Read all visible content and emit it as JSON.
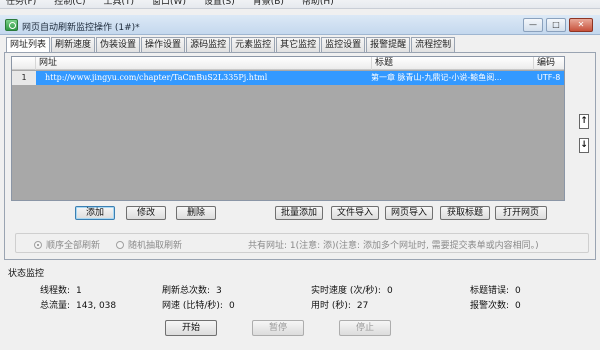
{
  "menu": [
    "任务(F)",
    "控制(C)",
    "工具(T)",
    "窗口(W)",
    "设置(S)",
    "背景(B)",
    "帮助(H)"
  ],
  "window": {
    "title": "网页自动刷新监控操作  (1#)*",
    "min": "—",
    "max": "□",
    "close": "✕"
  },
  "tabs": [
    "网址列表",
    "刷新速度",
    "伪装设置",
    "操作设置",
    "源码监控",
    "元素监控",
    "其它监控",
    "监控设置",
    "报警提醒",
    "流程控制"
  ],
  "table": {
    "headers": {
      "url": "网址",
      "title": "标题",
      "encoding": "编码"
    },
    "rows": [
      {
        "index": "1",
        "url": "http://www.jingyu.com/chapter/TaCmBuS2L335Pj.html",
        "title": "第一章 脉青山-九鼎记-小说-鲸鱼阅...",
        "encoding": "UTF-8"
      }
    ]
  },
  "scroll": {
    "up": "↑",
    "down": "↓"
  },
  "buttons": {
    "add": "添加",
    "edit": "修改",
    "delete": "删除",
    "batch_add": "批量添加",
    "file_import": "文件导入",
    "web_import": "网页导入",
    "get_title": "获取标题",
    "open_page": "打开网页"
  },
  "refresh_mode": {
    "sequential": "顺序全部刷新",
    "random": "随机抽取刷新",
    "hint": "共有网址: 1(注意: 添)(注意: 添加多个网址时, 需要提交表单或内容相同。)"
  },
  "status": {
    "section_title": "状态监控",
    "threads_label": "线程数:",
    "threads": "1",
    "total_refresh_label": "刷新总次数:",
    "total_refresh": "3",
    "realtime_speed_label": "实时速度 (次/秒):",
    "realtime_speed": "0",
    "title_errors_label": "标题错误:",
    "title_errors": "0",
    "total_traffic_label": "总流量:",
    "total_traffic": "143, 038",
    "net_speed_label": "网速 (比特/秒):",
    "net_speed": "0",
    "elapsed_label": "用时 (秒):",
    "elapsed": "27",
    "alarm_count_label": "报警次数:",
    "alarm_count": "0"
  },
  "controls": {
    "start": "开始",
    "pause": "暂停",
    "stop": "停止"
  }
}
